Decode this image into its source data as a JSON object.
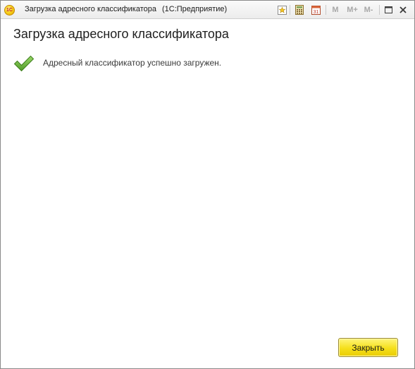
{
  "window": {
    "app_logo_text": "1C",
    "title": "Загрузка адресного классификатора",
    "app_name": "(1С:Предприятие)",
    "toolbar": {
      "calendar_day": "31",
      "memory_m": "M",
      "memory_m_plus": "M+",
      "memory_m_minus": "M-"
    }
  },
  "form": {
    "title": "Загрузка адресного классификатора",
    "message": "Адресный классификатор успешно загружен.",
    "close_label": "Закрыть"
  },
  "colors": {
    "accent_button": "#f5df1a",
    "success_icon": "#6cbf3a"
  }
}
